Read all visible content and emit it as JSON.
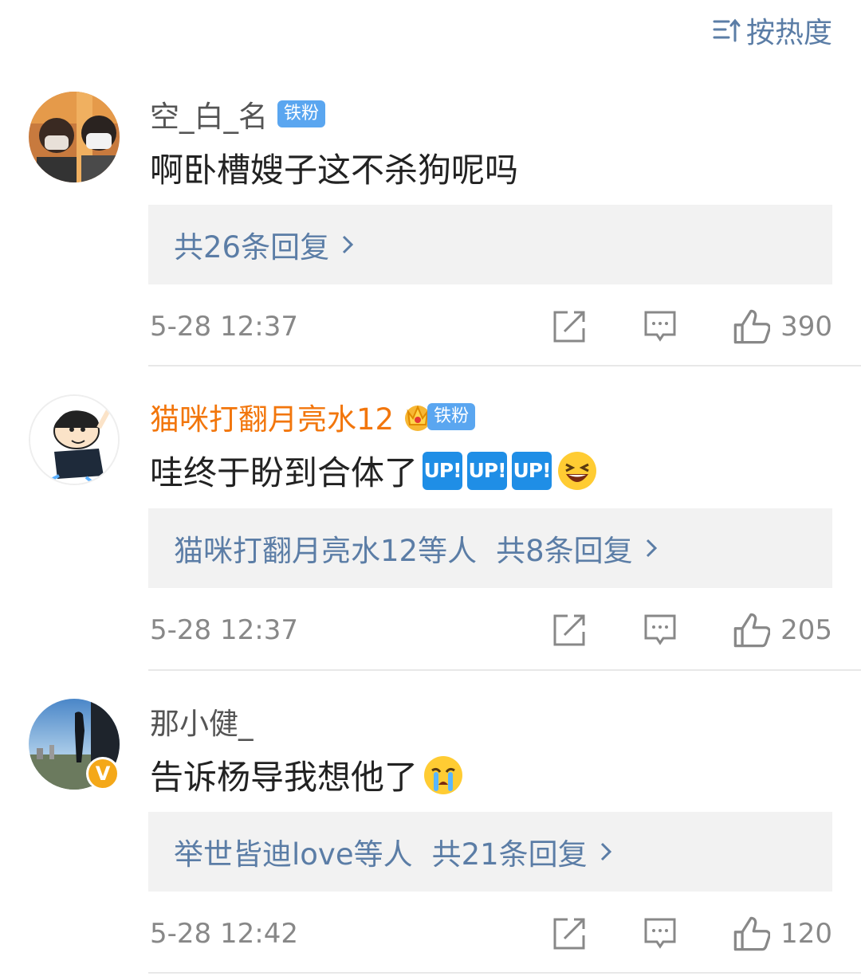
{
  "sort": {
    "label": "按热度"
  },
  "comments": [
    {
      "username": "空_白_名",
      "badge": "铁粉",
      "text": "啊卧槽嫂子这不杀狗呢吗",
      "reply_summary": "共26条回复",
      "time": "5-28 12:37",
      "likes": "390"
    },
    {
      "username": "猫咪打翻月亮水12",
      "badge": "铁粉",
      "text": "哇终于盼到合体了",
      "up_label": "UP!",
      "reply_prefix": "猫咪打翻月亮水12等人",
      "reply_summary": "共8条回复",
      "time": "5-28 12:37",
      "likes": "205"
    },
    {
      "username": "那小健_",
      "verified_mark": "V",
      "text": "告诉杨导我想他了",
      "reply_prefix": "举世皆迪love等人",
      "reply_summary": "共21条回复",
      "time": "5-28 12:42",
      "likes": "120"
    }
  ],
  "colors": {
    "link": "#5b7da6",
    "vip_name": "#f2760c",
    "badge": "#5aa6f0",
    "reply_bg": "#f2f2f2"
  },
  "icons": [
    "sort-icon",
    "chevron-right-icon",
    "share-icon",
    "comment-icon",
    "like-icon",
    "crown-icon",
    "laugh-emoji-icon",
    "cry-emoji-icon",
    "verified-icon"
  ]
}
